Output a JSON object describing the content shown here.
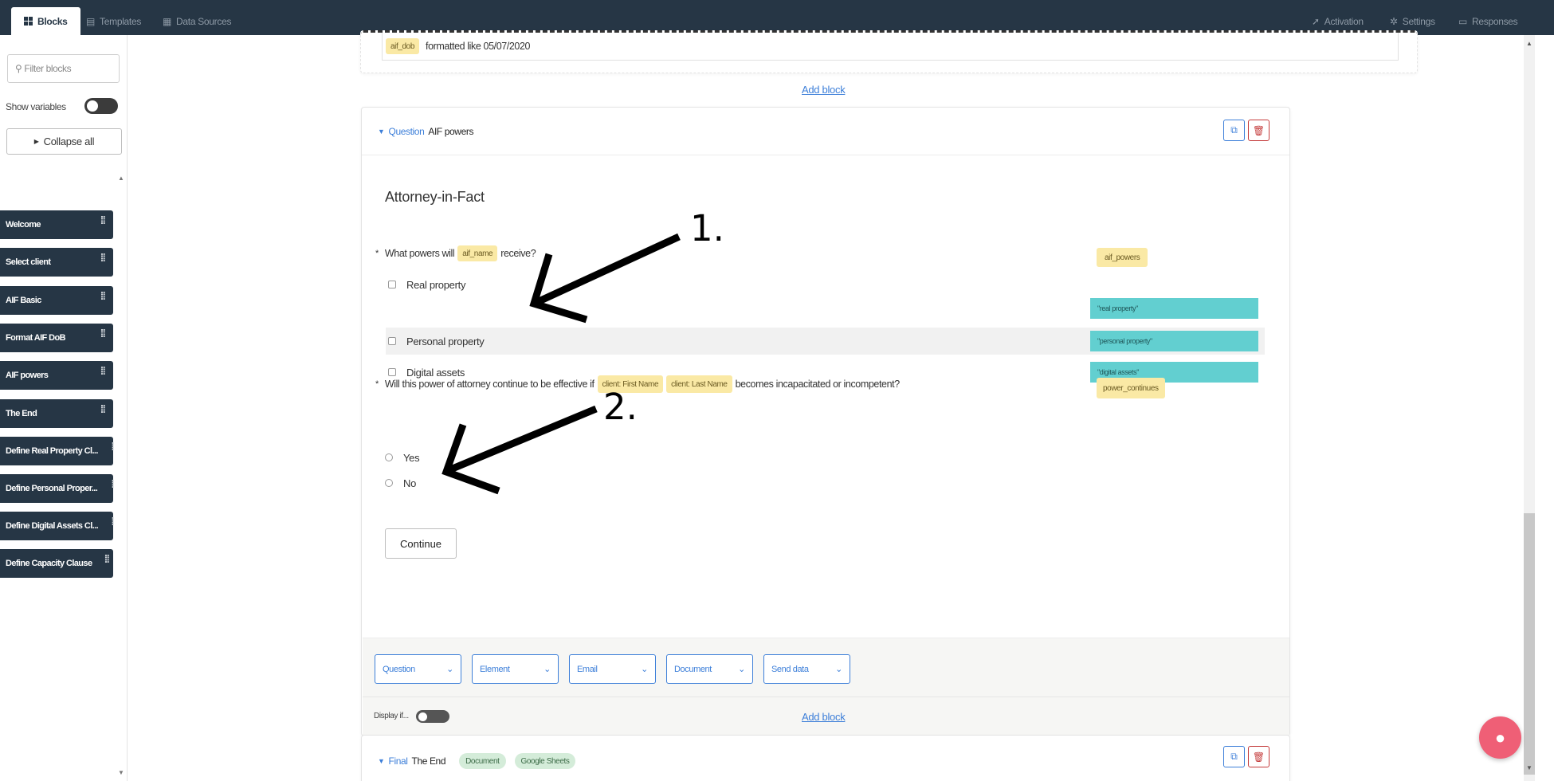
{
  "topnav": {
    "tabs": [
      {
        "label": "Blocks",
        "icon": "grid-icon"
      },
      {
        "label": "Templates",
        "icon": "file-icon"
      },
      {
        "label": "Data Sources",
        "icon": "table-icon"
      }
    ],
    "right_tabs": [
      {
        "label": "Activation",
        "icon": "rocket-icon"
      },
      {
        "label": "Settings",
        "icon": "gear-icon"
      },
      {
        "label": "Responses",
        "icon": "inbox-icon"
      }
    ]
  },
  "sidebar": {
    "filter_placeholder": "Filter blocks",
    "show_variables_label": "Show variables",
    "collapse_all_label": "Collapse all",
    "blocks": [
      {
        "label": "Welcome"
      },
      {
        "label": "Select client"
      },
      {
        "label": "AIF Basic"
      },
      {
        "label": "Format AIF DoB"
      },
      {
        "label": "AIF powers"
      },
      {
        "label": "The End"
      },
      {
        "label": "Define Real Property Cl..."
      },
      {
        "label": "Define Personal Proper..."
      },
      {
        "label": "Define Digital Assets Cl..."
      },
      {
        "label": "Define Capacity Clause"
      }
    ]
  },
  "prev_card": {
    "var_pill": "aif_dob",
    "text": "formatted like 05/07/2020"
  },
  "add_block_label": "Add block",
  "question_card": {
    "kind": "Question",
    "name": "AIF powers",
    "title": "Attorney-in-Fact",
    "q1": {
      "star": "*",
      "prefix": "What powers will",
      "var": "aif_name",
      "suffix": "receive?",
      "output_var": "aif_powers",
      "options": [
        {
          "label": "Real property",
          "value": "\"real property\""
        },
        {
          "label": "Personal property",
          "value": "\"personal property\""
        },
        {
          "label": "Digital assets",
          "value": "\"digital assets\""
        }
      ]
    },
    "q2": {
      "star": "*",
      "prefix": "Will this power of attorney continue to be effective if",
      "var1": "client: First Name",
      "var2": "client: Last Name",
      "suffix": "becomes incapacitated or incompetent?",
      "output_var": "power_continues",
      "options": [
        {
          "label": "Yes"
        },
        {
          "label": "No"
        }
      ]
    },
    "continue_label": "Continue",
    "toolbar": [
      "Question",
      "Element",
      "Email",
      "Document",
      "Send data"
    ],
    "display_if_label": "Display if..."
  },
  "final_card": {
    "kind": "Final",
    "name": "The End",
    "pills": [
      "Document",
      "Google Sheets"
    ]
  },
  "annotations": [
    "1.",
    "2."
  ],
  "colors": {
    "nav_bg": "#263645",
    "accent_blue": "#3d7fd9",
    "variable_yellow": "#fae9a5",
    "value_teal": "#62cfd0",
    "danger_red": "#c43b3b",
    "help_pink": "#ef5f76"
  }
}
